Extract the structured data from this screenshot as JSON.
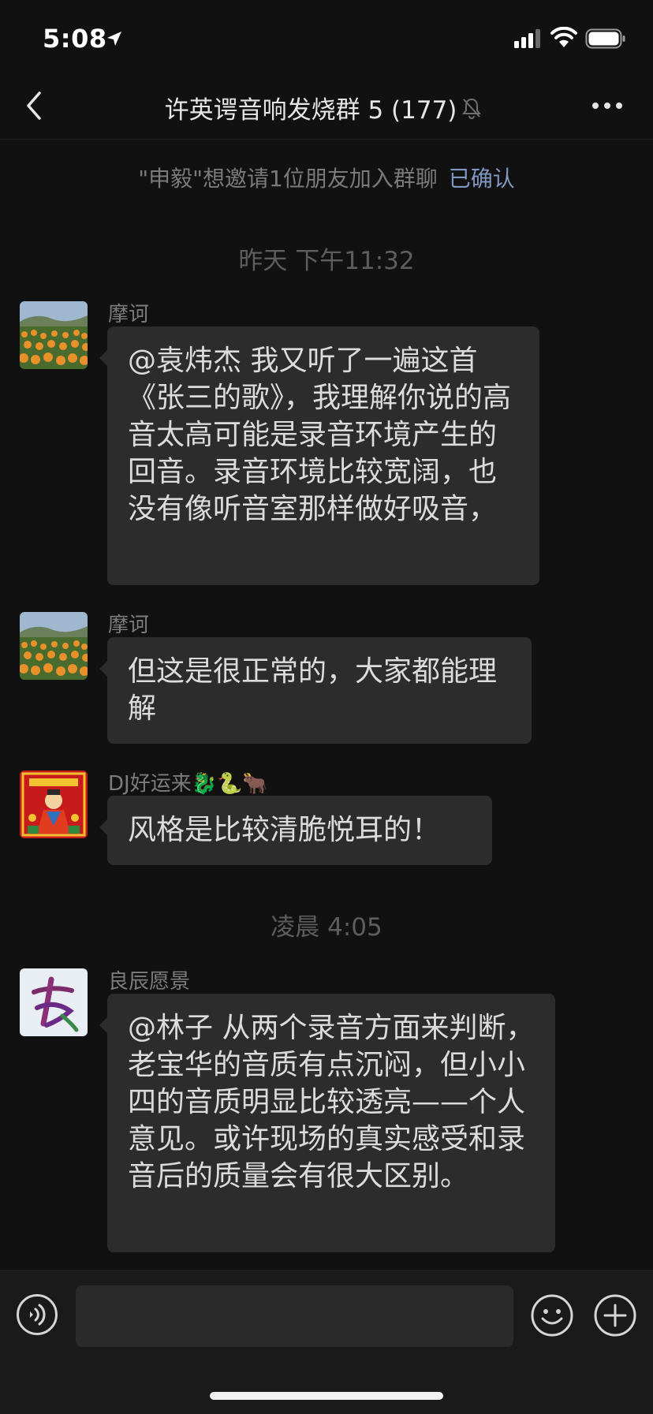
{
  "status_bar": {
    "time": "5:08",
    "location_icon": "location-arrow-icon",
    "signal_icon": "cellular-signal-icon",
    "wifi_icon": "wifi-icon",
    "battery_icon": "battery-icon"
  },
  "nav": {
    "back_icon": "chevron-left-icon",
    "title": "许英谔音响发烧群 5 (177)",
    "mute_icon": "muted-bell-icon",
    "more_icon": "more-dots-icon"
  },
  "notice": {
    "text": "\"申毅\"想邀请1位朋友加入群聊",
    "action": "已确认"
  },
  "timestamps": {
    "first": "昨天 下午11:32",
    "second": "凌晨 4:05"
  },
  "messages": [
    {
      "sender": "摩诃",
      "avatar": "flower-field-avatar",
      "text": "@袁炜杰 我又听了一遍这首《张三的歌》，我理解你说的高音太高可能是录音环境产生的回音。录音环境比较宽阔，也没有像听音室那样做好吸音，"
    },
    {
      "sender": "摩诃",
      "avatar": "flower-field-avatar",
      "text": "但这是很正常的，大家都能理解"
    },
    {
      "sender": "DJ好运来🐉🐍🐂",
      "avatar": "fortune-god-avatar",
      "text": "风格是比较清脆悦耳的！"
    },
    {
      "sender": "良辰愿景",
      "avatar": "calligraphy-avatar",
      "text": "@林子 从两个录音方面来判断，老宝华的音质有点沉闷，但小小四的音质明显比较透亮——个人意见。或许现场的真实感受和录音后的质量会有很大区别。"
    }
  ],
  "input_bar": {
    "voice_icon": "voice-input-icon",
    "input_value": "",
    "emoji_icon": "emoji-smile-icon",
    "add_icon": "plus-circle-icon"
  },
  "colors": {
    "background": "#111111",
    "bubble": "#2c2c2c",
    "link": "#7f97c2",
    "input_bar": "#1a1a1a"
  }
}
